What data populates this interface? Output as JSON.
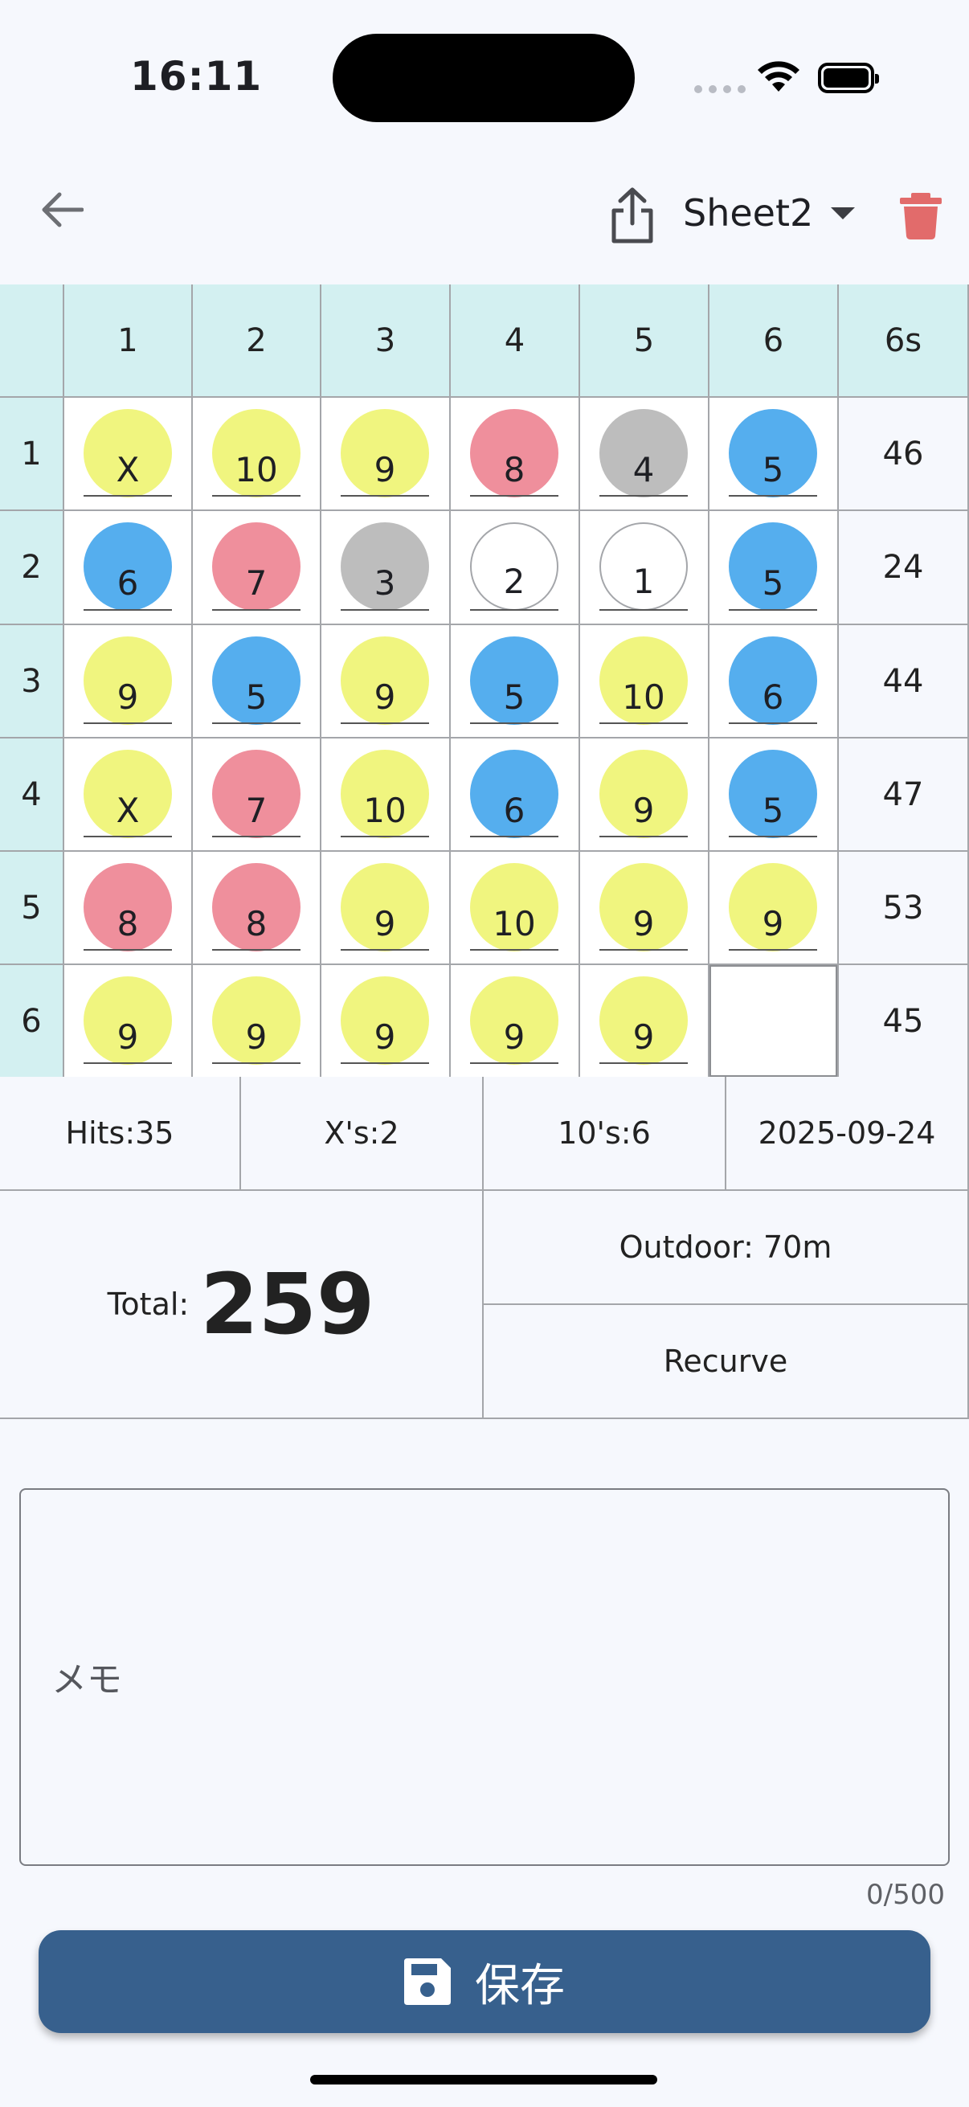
{
  "status_bar": {
    "time": "16:11"
  },
  "app_bar": {
    "sheet_name": "Sheet2"
  },
  "scoresheet": {
    "column_headers": [
      "1",
      "2",
      "3",
      "4",
      "5",
      "6",
      "6s"
    ],
    "rows": [
      {
        "label": "1",
        "arrows": [
          "X",
          "10",
          "9",
          "8",
          "4",
          "5"
        ],
        "sum": "46"
      },
      {
        "label": "2",
        "arrows": [
          "6",
          "7",
          "3",
          "2",
          "1",
          "5"
        ],
        "sum": "24"
      },
      {
        "label": "3",
        "arrows": [
          "9",
          "5",
          "9",
          "5",
          "10",
          "6"
        ],
        "sum": "44"
      },
      {
        "label": "4",
        "arrows": [
          "X",
          "7",
          "10",
          "6",
          "9",
          "5"
        ],
        "sum": "47"
      },
      {
        "label": "5",
        "arrows": [
          "8",
          "8",
          "9",
          "10",
          "9",
          "9"
        ],
        "sum": "53"
      },
      {
        "label": "6",
        "arrows": [
          "9",
          "9",
          "9",
          "9",
          "9",
          ""
        ],
        "sum": "45"
      }
    ],
    "score_colors": {
      "gold": "#f0f57f",
      "red": "#ef8f9c",
      "blue": "#55aeee",
      "black": "#bdbdbd",
      "white": "#ffffff"
    }
  },
  "stats": {
    "hits": "Hits:35",
    "xs": "X's:2",
    "tens": "10's:6",
    "date": "2025-09-24",
    "total_label": "Total:",
    "total_value": "259",
    "distance": "Outdoor: 70m",
    "bow": "Recurve"
  },
  "memo": {
    "placeholder": "メモ",
    "counter": "0/500"
  },
  "save_button": {
    "label": "保存"
  },
  "colors": {
    "header_bg": "#d3f0f1",
    "accent": "#37608d",
    "delete": "#e26b6b"
  }
}
